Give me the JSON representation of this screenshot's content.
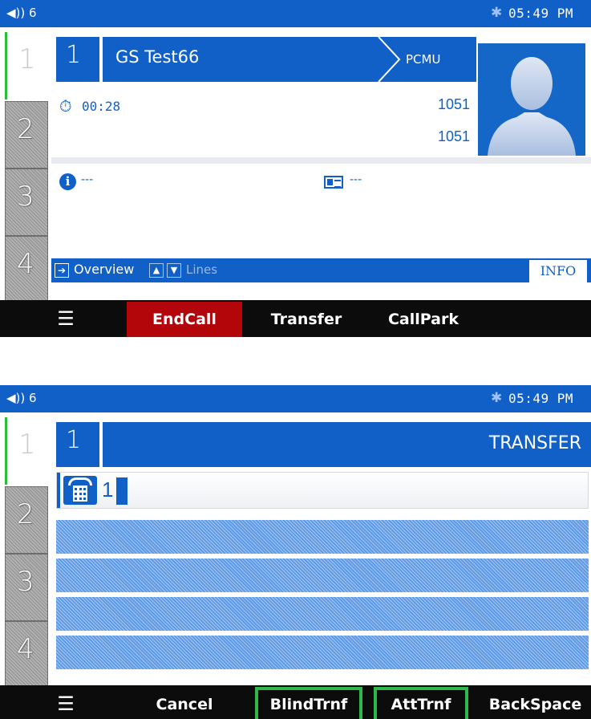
{
  "status": {
    "volume_level": "6",
    "time": "05:49 PM"
  },
  "line_keys": [
    "1",
    "2",
    "3",
    "4"
  ],
  "call_screen": {
    "line_number": "1",
    "caller_name": "GS Test66",
    "codec": "PCMU",
    "timer": "00:28",
    "numbers": [
      "1051",
      "1051"
    ],
    "info_value": "---",
    "contact_value": "---",
    "nav": {
      "overview_label": "Overview",
      "lines_label": "Lines",
      "info_tab": "INFO"
    },
    "softkeys": [
      "EndCall",
      "Transfer",
      "CallPark"
    ]
  },
  "transfer_screen": {
    "line_number": "1",
    "title": "TRANSFER",
    "dialed": "1",
    "softkeys": [
      "Cancel",
      "BlindTrnf",
      "AttTrnf",
      "BackSpace"
    ],
    "highlighted_softkeys": [
      "BlindTrnf",
      "AttTrnf"
    ]
  },
  "colors": {
    "accent": "#1160c8",
    "end_call": "#b3060a",
    "highlight": "#2fb84a",
    "active_line": "#2dbb3a"
  }
}
